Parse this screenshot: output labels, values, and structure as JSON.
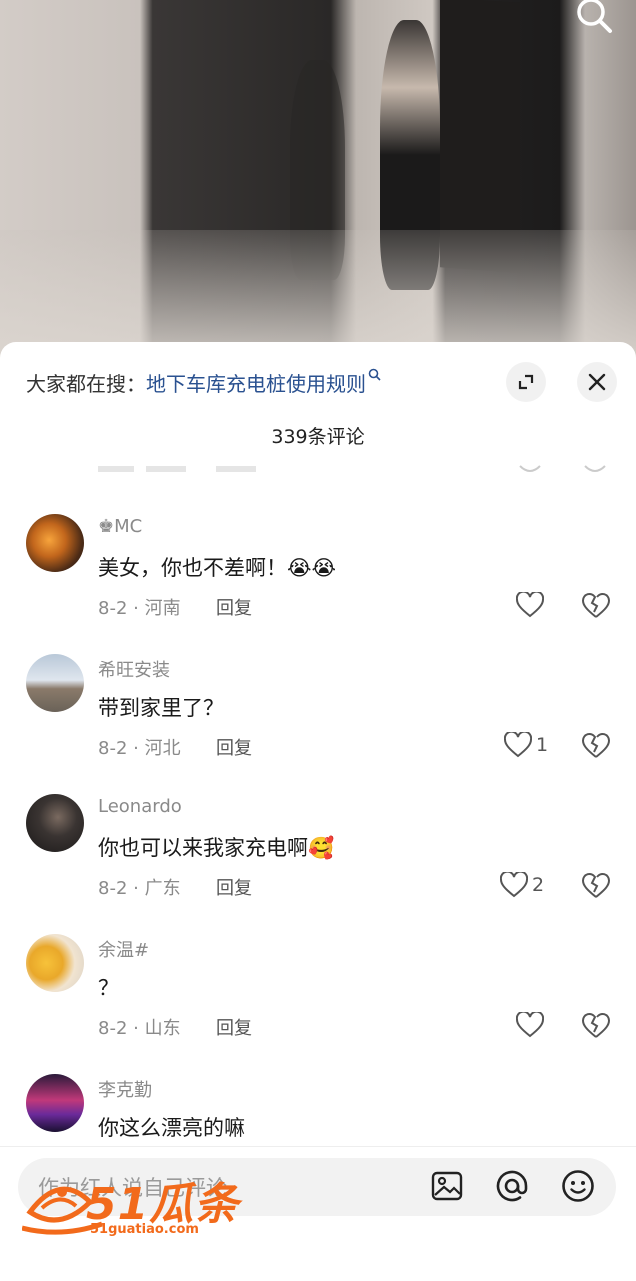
{
  "video": {
    "search_icon": "search-icon"
  },
  "sheet": {
    "hot_search_prefix": "大家都在搜：",
    "hot_search_keyword": "地下车库充电桩使用规则",
    "expand_icon": "expand-icon",
    "close_icon": "close-icon",
    "comment_count": "339条评论"
  },
  "comments": [
    {
      "name": "♚MC",
      "text": "美女，你也不差啊！",
      "emoji": "😭😭",
      "meta": "8-2 · 河南",
      "reply": "回复",
      "likes": ""
    },
    {
      "name": "希旺安装",
      "text": "带到家里了？",
      "emoji": "",
      "meta": "8-2 · 河北",
      "reply": "回复",
      "likes": "1"
    },
    {
      "name": "Leonardo",
      "text": "你也可以来我家充电啊",
      "emoji": "🥰",
      "meta": "8-2 · 广东",
      "reply": "回复",
      "likes": "2"
    },
    {
      "name": "余温#",
      "text": "？",
      "emoji": "",
      "meta": "8-2 · 山东",
      "reply": "回复",
      "likes": ""
    },
    {
      "name": "李克勤",
      "text": "你这么漂亮的嘛",
      "emoji": "",
      "meta": "",
      "reply": "",
      "likes": ""
    }
  ],
  "input": {
    "placeholder": "作为红人说自己评论",
    "image_icon": "image-icon",
    "at_icon": "at-icon",
    "emoji_icon": "emoji-icon"
  },
  "watermark": {
    "text": "51瓜条",
    "url": "51guatiao.com"
  },
  "colors": {
    "keyword": "#2a5190",
    "watermark": "#f26a1b"
  }
}
